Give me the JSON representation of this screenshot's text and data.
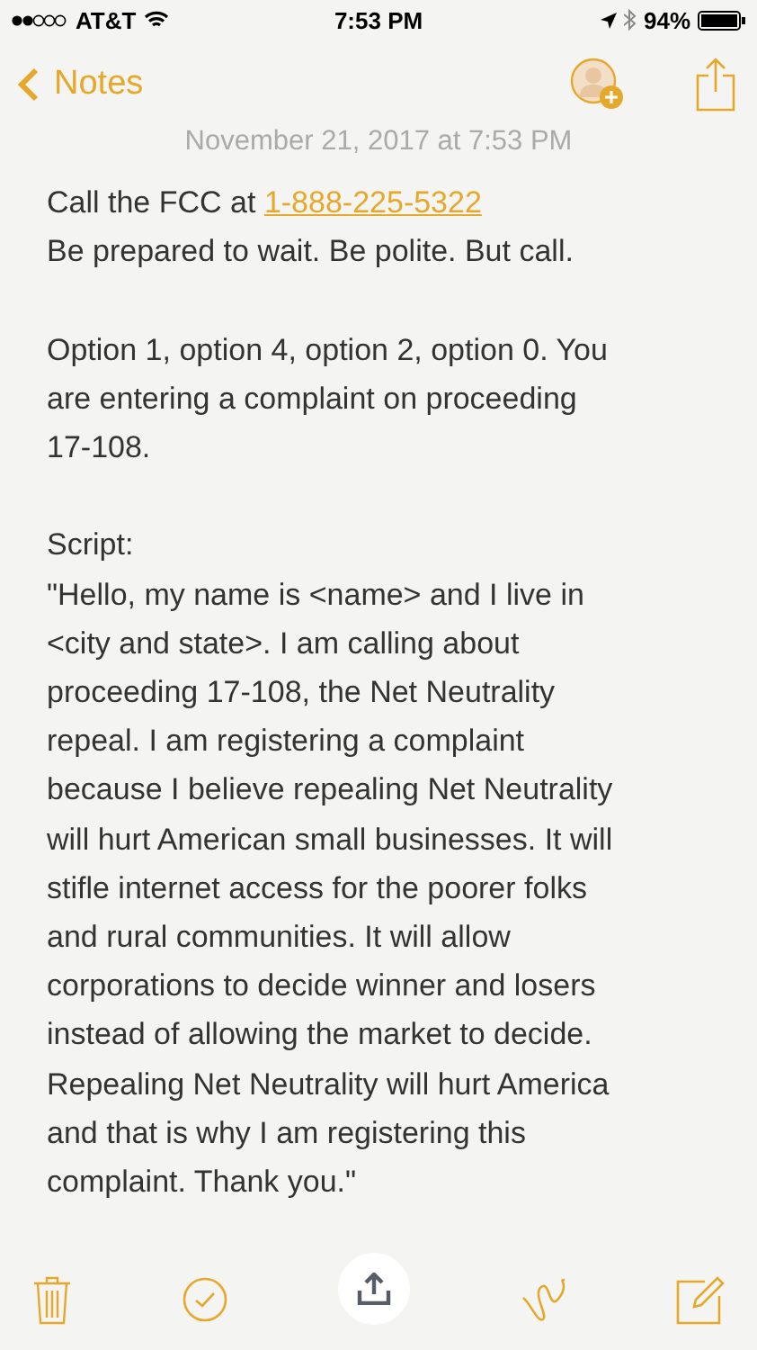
{
  "status_bar": {
    "carrier": "AT&T",
    "time": "7:53 PM",
    "battery": "94%"
  },
  "nav": {
    "back": "Notes"
  },
  "date": "November 21, 2017 at 7:53 PM",
  "paragraphs": [
    {
      "lines": [
        {
          "text": "Call the FCC at ",
          "link": "1-888-225-5322"
        },
        {
          "text": "Be prepared to wait. Be polite. But call."
        }
      ]
    },
    {
      "lines": [
        {
          "text": "Option 1, option 4, option 2, option 0. You"
        },
        {
          "text": "are entering a complaint on proceeding"
        },
        {
          "text": "17-108."
        }
      ]
    },
    {
      "lines": [
        {
          "text": "Script:"
        },
        {
          "text": "\"Hello, my name is <name> and I live in"
        },
        {
          "text": "<city and state>. I am calling about"
        },
        {
          "text": "proceeding 17-108, the Net Neutrality"
        },
        {
          "text": "repeal. I am registering a complaint"
        },
        {
          "text": "because I believe repealing Net Neutrality"
        },
        {
          "text": "will hurt American small businesses. It will"
        },
        {
          "text": "stifle internet access for the poorer folks"
        },
        {
          "text": "and rural communities. It will allow"
        },
        {
          "text": "corporations to decide winner and losers"
        },
        {
          "text": "instead of allowing the market to decide."
        },
        {
          "text": "Repealing Net Neutrality will hurt America"
        },
        {
          "text": "and that is why I am registering this"
        },
        {
          "text": "complaint. Thank you.\""
        }
      ]
    }
  ]
}
